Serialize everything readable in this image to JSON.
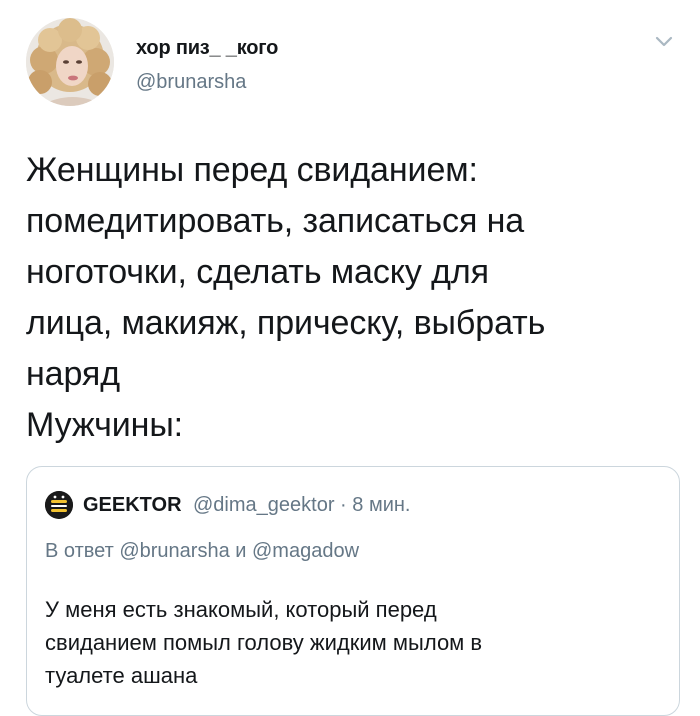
{
  "tweet": {
    "author": {
      "display_name": "хор пиз_ _кого",
      "handle": "@brunarsha",
      "avatar_icon": "profile-photo"
    },
    "menu_icon": "chevron-down-icon",
    "body_lines": [
      "Женщины перед свиданием:",
      "помедитировать, записаться на",
      "ноготочки, сделать маску для",
      "лица, макияж, прическу, выбрать",
      "наряд",
      "Мужчины:"
    ]
  },
  "quote": {
    "author_name": "GEEKTOR",
    "author_handle": "@dima_geektor",
    "separator": "·",
    "time": "8 мин.",
    "replying_to_prefix": "В ответ",
    "replying_to_user1": "@brunarsha",
    "replying_to_conj": "и",
    "replying_to_user2": "@magadow",
    "text_lines": [
      "У меня есть знакомый, который перед",
      "свиданием помыл голову жидким мылом в",
      "туалете ашана"
    ],
    "avatar_icon": "geektor-logo"
  },
  "colors": {
    "text": "#14171a",
    "secondary": "#657786",
    "border": "#ccd6dd"
  }
}
